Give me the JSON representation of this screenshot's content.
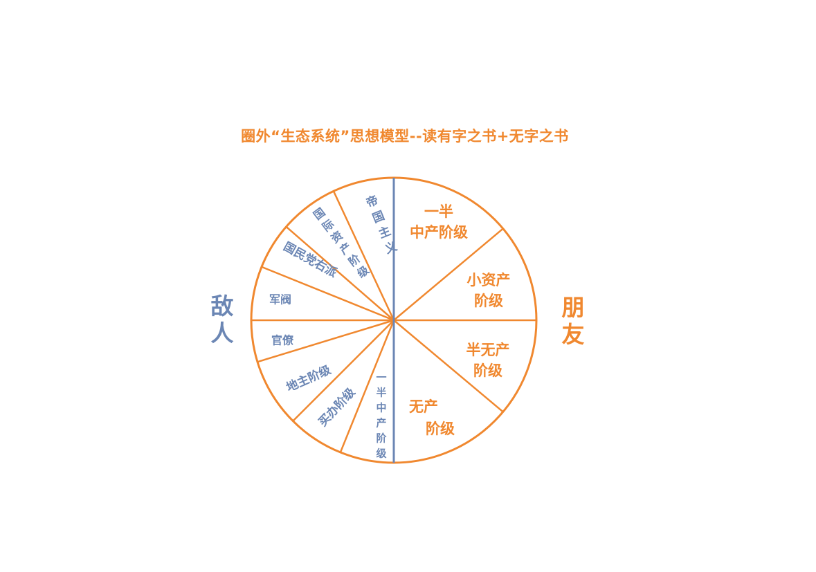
{
  "title": "圈外“生态系统”思想模型--读有字之书+无字之书",
  "enemy_label": "敌人",
  "friend_label": "朋友",
  "colors": {
    "orange": "#F0882F",
    "blue": "#6B86B4",
    "title": "#F0882F"
  },
  "enemy_segments": [
    {
      "id": "imperialism",
      "lines": [
        "帝",
        "国",
        "主",
        "义"
      ]
    },
    {
      "id": "intl-capitalist",
      "lines": [
        "国",
        "际",
        "资",
        "产",
        "阶",
        "级"
      ]
    },
    {
      "id": "kmt-right",
      "lines": [
        "国民党右派"
      ]
    },
    {
      "id": "warlords",
      "lines": [
        "军阀"
      ]
    },
    {
      "id": "bureaucrats",
      "lines": [
        "官僚"
      ]
    },
    {
      "id": "landlords",
      "lines": [
        "地主阶级"
      ]
    },
    {
      "id": "comprador",
      "lines": [
        "买办阶级"
      ]
    },
    {
      "id": "half-middle-enemy",
      "lines": [
        "一",
        "半",
        "中",
        "产",
        "阶",
        "级"
      ]
    }
  ],
  "friend_segments": [
    {
      "id": "half-middle-friend",
      "lines": [
        "一半",
        "中产阶级"
      ]
    },
    {
      "id": "petty-bourgeois",
      "lines": [
        "小资产",
        "阶级"
      ]
    },
    {
      "id": "semi-proletariat",
      "lines": [
        "半无产",
        "阶级"
      ]
    },
    {
      "id": "proletariat",
      "lines": [
        "无产",
        "阶级"
      ]
    }
  ]
}
